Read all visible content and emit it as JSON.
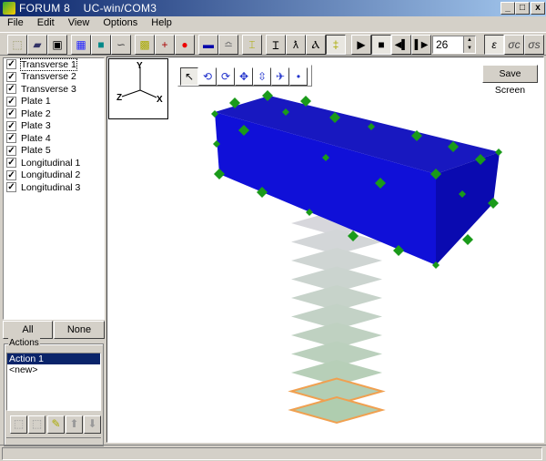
{
  "window": {
    "title": "FORUM 8    UC-win/COM3",
    "minimize": "_",
    "maximize": "□",
    "close": "x"
  },
  "menu": [
    "File",
    "Edit",
    "View",
    "Options",
    "Help"
  ],
  "toolbar": {
    "frame_value": "26",
    "strain_label": "ε",
    "sigma_c_label": "σc",
    "sigma_s_label": "σs",
    "active_tool": "strain"
  },
  "layers": [
    {
      "label": "Transverse 1",
      "checked": true
    },
    {
      "label": "Transverse 2",
      "checked": true
    },
    {
      "label": "Transverse 3",
      "checked": true
    },
    {
      "label": "Plate 1",
      "checked": true
    },
    {
      "label": "Plate 2",
      "checked": true
    },
    {
      "label": "Plate 3",
      "checked": true
    },
    {
      "label": "Plate 4",
      "checked": true
    },
    {
      "label": "Plate 5",
      "checked": true
    },
    {
      "label": "Longitudinal 1",
      "checked": true
    },
    {
      "label": "Longitudinal 2",
      "checked": true
    },
    {
      "label": "Longitudinal 3",
      "checked": true
    }
  ],
  "select_buttons": {
    "all": "All",
    "none": "None"
  },
  "actions": {
    "legend": "Actions",
    "items": [
      {
        "label": "Action 1",
        "selected": true
      },
      {
        "label": "<new>",
        "selected": false
      }
    ]
  },
  "viewport": {
    "save_screen": "Save Screen",
    "axes": {
      "x": "X",
      "y": "Y",
      "z": "Z"
    },
    "colors": {
      "box": "#1010d0",
      "markers": "#1a9a1a",
      "plate_edge_highlight": "#f0a050"
    }
  },
  "status": ""
}
